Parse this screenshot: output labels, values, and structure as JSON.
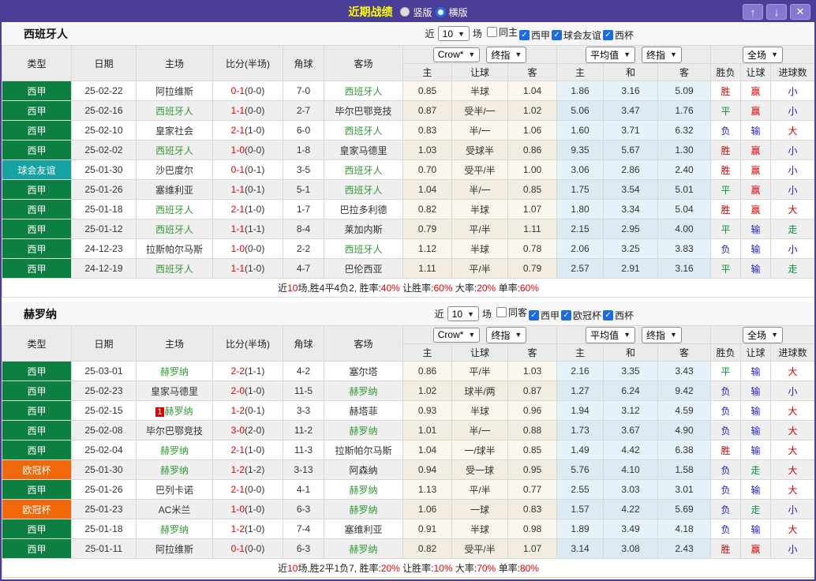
{
  "titlebar": {
    "title": "近期战绩",
    "radio_vertical": "竖版",
    "radio_horizontal": "横版",
    "up_icon": "↑",
    "down_icon": "↓",
    "close_icon": "✕"
  },
  "colors": {
    "accent_purple": "#4a3e96",
    "league": {
      "西甲": "#0d7f41",
      "球会友谊": "#16a3a3",
      "欧冠杯": "#f0680a"
    },
    "char": {
      "胜": "#dd0000",
      "平": "#009933",
      "负": "#2222cc",
      "赢": "#dd0000",
      "输": "#2222cc",
      "走": "#009933",
      "大": "#dd0000",
      "小": "#2222cc"
    }
  },
  "header_labels": {
    "recent_prefix": "近",
    "recent_suffix": "场",
    "col_type": "类型",
    "col_date": "日期",
    "col_home": "主场",
    "col_score": "比分(半场)",
    "col_corner": "角球",
    "col_away": "客场",
    "dd_crow": "Crow*",
    "dd_final1": "终指",
    "dd_avg": "平均值",
    "dd_final2": "终指",
    "dd_fulltime": "全场",
    "sub_home": "主",
    "sub_handicap": "让球",
    "sub_away": "客",
    "sub_avg_home": "主",
    "sub_draw": "和",
    "sub_avg_away": "客",
    "col_result": "胜负",
    "col_handicap_result": "让球",
    "col_goals": "进球数"
  },
  "tables": [
    {
      "team": "西班牙人",
      "recent_count": "10",
      "filters": [
        {
          "label": "同主",
          "checked": false
        },
        {
          "label": "西甲",
          "checked": true
        },
        {
          "label": "球会友谊",
          "checked": true
        },
        {
          "label": "西杯",
          "checked": true
        }
      ],
      "rows": [
        {
          "league": "西甲",
          "date": "25-02-22",
          "home": "阿拉维斯",
          "score": "0-1",
          "half": "(0-0)",
          "corner": "7-0",
          "away": "西班牙人",
          "crow_home": "0.85",
          "handicap": "半球",
          "crow_away": "1.04",
          "avg_home": "1.86",
          "avg_draw": "3.16",
          "avg_away": "5.09",
          "result": "胜",
          "handicap_result": "赢",
          "goals": "小"
        },
        {
          "league": "西甲",
          "date": "25-02-16",
          "home": "西班牙人",
          "score": "1-1",
          "half": "(0-0)",
          "corner": "2-7",
          "away": "毕尔巴鄂竞技",
          "crow_home": "0.87",
          "handicap": "受半/一",
          "crow_away": "1.02",
          "avg_home": "5.06",
          "avg_draw": "3.47",
          "avg_away": "1.76",
          "result": "平",
          "handicap_result": "赢",
          "goals": "小"
        },
        {
          "league": "西甲",
          "date": "25-02-10",
          "home": "皇家社会",
          "score": "2-1",
          "half": "(1-0)",
          "corner": "6-0",
          "away": "西班牙人",
          "crow_home": "0.83",
          "handicap": "半/一",
          "crow_away": "1.06",
          "avg_home": "1.60",
          "avg_draw": "3.71",
          "avg_away": "6.32",
          "result": "负",
          "handicap_result": "输",
          "goals": "大"
        },
        {
          "league": "西甲",
          "date": "25-02-02",
          "home": "西班牙人",
          "score": "1-0",
          "half": "(0-0)",
          "corner": "1-8",
          "away": "皇家马德里",
          "crow_home": "1.03",
          "handicap": "受球半",
          "crow_away": "0.86",
          "avg_home": "9.35",
          "avg_draw": "5.67",
          "avg_away": "1.30",
          "result": "胜",
          "handicap_result": "赢",
          "goals": "小"
        },
        {
          "league": "球会友谊",
          "date": "25-01-30",
          "home": "沙巴度尔",
          "score": "0-1",
          "half": "(0-1)",
          "corner": "3-5",
          "away": "西班牙人",
          "crow_home": "0.70",
          "handicap": "受平/半",
          "crow_away": "1.00",
          "avg_home": "3.06",
          "avg_draw": "2.86",
          "avg_away": "2.40",
          "result": "胜",
          "handicap_result": "赢",
          "goals": "小"
        },
        {
          "league": "西甲",
          "date": "25-01-26",
          "home": "塞维利亚",
          "score": "1-1",
          "half": "(0-1)",
          "corner": "5-1",
          "away": "西班牙人",
          "crow_home": "1.04",
          "handicap": "半/一",
          "crow_away": "0.85",
          "avg_home": "1.75",
          "avg_draw": "3.54",
          "avg_away": "5.01",
          "result": "平",
          "handicap_result": "赢",
          "goals": "小"
        },
        {
          "league": "西甲",
          "date": "25-01-18",
          "home": "西班牙人",
          "score": "2-1",
          "half": "(1-0)",
          "corner": "1-7",
          "away": "巴拉多利德",
          "crow_home": "0.82",
          "handicap": "半球",
          "crow_away": "1.07",
          "avg_home": "1.80",
          "avg_draw": "3.34",
          "avg_away": "5.04",
          "result": "胜",
          "handicap_result": "赢",
          "goals": "大"
        },
        {
          "league": "西甲",
          "date": "25-01-12",
          "home": "西班牙人",
          "score": "1-1",
          "half": "(1-1)",
          "corner": "8-4",
          "away": "莱加内斯",
          "crow_home": "0.79",
          "handicap": "平/半",
          "crow_away": "1.11",
          "avg_home": "2.15",
          "avg_draw": "2.95",
          "avg_away": "4.00",
          "result": "平",
          "handicap_result": "输",
          "goals": "走"
        },
        {
          "league": "西甲",
          "date": "24-12-23",
          "home": "拉斯帕尔马斯",
          "score": "1-0",
          "half": "(0-0)",
          "corner": "2-2",
          "away": "西班牙人",
          "crow_home": "1.12",
          "handicap": "半球",
          "crow_away": "0.78",
          "avg_home": "2.06",
          "avg_draw": "3.25",
          "avg_away": "3.83",
          "result": "负",
          "handicap_result": "输",
          "goals": "小"
        },
        {
          "league": "西甲",
          "date": "24-12-19",
          "home": "西班牙人",
          "score": "1-1",
          "half": "(1-0)",
          "corner": "4-7",
          "away": "巴伦西亚",
          "crow_home": "1.11",
          "handicap": "平/半",
          "crow_away": "0.79",
          "avg_home": "2.57",
          "avg_draw": "2.91",
          "avg_away": "3.16",
          "result": "平",
          "handicap_result": "输",
          "goals": "走"
        }
      ],
      "summary": [
        {
          "t": "近"
        },
        {
          "t": "10",
          "red": true
        },
        {
          "t": "场,胜4平4负2, 胜率:"
        },
        {
          "t": "40%",
          "red": true
        },
        {
          "t": " 让胜率:"
        },
        {
          "t": "60%",
          "red": true
        },
        {
          "t": " 大率:"
        },
        {
          "t": "20%",
          "red": true
        },
        {
          "t": " 单率:"
        },
        {
          "t": "60%",
          "red": true
        }
      ]
    },
    {
      "team": "赫罗纳",
      "recent_count": "10",
      "filters": [
        {
          "label": "同客",
          "checked": false
        },
        {
          "label": "西甲",
          "checked": true
        },
        {
          "label": "欧冠杯",
          "checked": true
        },
        {
          "label": "西杯",
          "checked": true
        }
      ],
      "rows": [
        {
          "league": "西甲",
          "date": "25-03-01",
          "home": "赫罗纳",
          "score": "2-2",
          "half": "(1-1)",
          "corner": "4-2",
          "away": "塞尔塔",
          "crow_home": "0.86",
          "handicap": "平/半",
          "crow_away": "1.03",
          "avg_home": "2.16",
          "avg_draw": "3.35",
          "avg_away": "3.43",
          "result": "平",
          "handicap_result": "输",
          "goals": "大"
        },
        {
          "league": "西甲",
          "date": "25-02-23",
          "home": "皇家马德里",
          "score": "2-0",
          "half": "(1-0)",
          "corner": "11-5",
          "away": "赫罗纳",
          "crow_home": "1.02",
          "handicap": "球半/两",
          "crow_away": "0.87",
          "avg_home": "1.27",
          "avg_draw": "6.24",
          "avg_away": "9.42",
          "result": "负",
          "handicap_result": "输",
          "goals": "小"
        },
        {
          "league": "西甲",
          "date": "25-02-15",
          "home": "赫罗纳",
          "card": "1",
          "score": "1-2",
          "half": "(0-1)",
          "corner": "3-3",
          "away": "赫塔菲",
          "crow_home": "0.93",
          "handicap": "半球",
          "crow_away": "0.96",
          "avg_home": "1.94",
          "avg_draw": "3.12",
          "avg_away": "4.59",
          "result": "负",
          "handicap_result": "输",
          "goals": "大"
        },
        {
          "league": "西甲",
          "date": "25-02-08",
          "home": "毕尔巴鄂竞技",
          "score": "3-0",
          "half": "(2-0)",
          "corner": "11-2",
          "away": "赫罗纳",
          "crow_home": "1.01",
          "handicap": "半/一",
          "crow_away": "0.88",
          "avg_home": "1.73",
          "avg_draw": "3.67",
          "avg_away": "4.90",
          "result": "负",
          "handicap_result": "输",
          "goals": "大"
        },
        {
          "league": "西甲",
          "date": "25-02-04",
          "home": "赫罗纳",
          "score": "2-1",
          "half": "(1-0)",
          "corner": "11-3",
          "away": "拉斯帕尔马斯",
          "crow_home": "1.04",
          "handicap": "一/球半",
          "crow_away": "0.85",
          "avg_home": "1.49",
          "avg_draw": "4.42",
          "avg_away": "6.38",
          "result": "胜",
          "handicap_result": "输",
          "goals": "大"
        },
        {
          "league": "欧冠杯",
          "date": "25-01-30",
          "home": "赫罗纳",
          "score": "1-2",
          "half": "(1-2)",
          "corner": "3-13",
          "away": "阿森纳",
          "crow_home": "0.94",
          "handicap": "受一球",
          "crow_away": "0.95",
          "avg_home": "5.76",
          "avg_draw": "4.10",
          "avg_away": "1.58",
          "result": "负",
          "handicap_result": "走",
          "goals": "大"
        },
        {
          "league": "西甲",
          "date": "25-01-26",
          "home": "巴列卡诺",
          "score": "2-1",
          "half": "(0-0)",
          "corner": "4-1",
          "away": "赫罗纳",
          "crow_home": "1.13",
          "handicap": "平/半",
          "crow_away": "0.77",
          "avg_home": "2.55",
          "avg_draw": "3.03",
          "avg_away": "3.01",
          "result": "负",
          "handicap_result": "输",
          "goals": "大"
        },
        {
          "league": "欧冠杯",
          "date": "25-01-23",
          "home": "AC米兰",
          "score": "1-0",
          "half": "(1-0)",
          "corner": "6-3",
          "away": "赫罗纳",
          "crow_home": "1.06",
          "handicap": "一球",
          "crow_away": "0.83",
          "avg_home": "1.57",
          "avg_draw": "4.22",
          "avg_away": "5.69",
          "result": "负",
          "handicap_result": "走",
          "goals": "小"
        },
        {
          "league": "西甲",
          "date": "25-01-18",
          "home": "赫罗纳",
          "score": "1-2",
          "half": "(1-0)",
          "corner": "7-4",
          "away": "塞维利亚",
          "crow_home": "0.91",
          "handicap": "半球",
          "crow_away": "0.98",
          "avg_home": "1.89",
          "avg_draw": "3.49",
          "avg_away": "4.18",
          "result": "负",
          "handicap_result": "输",
          "goals": "大"
        },
        {
          "league": "西甲",
          "date": "25-01-11",
          "home": "阿拉维斯",
          "score": "0-1",
          "half": "(0-0)",
          "corner": "6-3",
          "away": "赫罗纳",
          "crow_home": "0.82",
          "handicap": "受平/半",
          "crow_away": "1.07",
          "avg_home": "3.14",
          "avg_draw": "3.08",
          "avg_away": "2.43",
          "result": "胜",
          "handicap_result": "赢",
          "goals": "小"
        }
      ],
      "summary": [
        {
          "t": "近"
        },
        {
          "t": "10",
          "red": true
        },
        {
          "t": "场,胜2平1负7, 胜率:"
        },
        {
          "t": "20%",
          "red": true
        },
        {
          "t": " 让胜率:"
        },
        {
          "t": "10%",
          "red": true
        },
        {
          "t": " 大率:"
        },
        {
          "t": "70%",
          "red": true
        },
        {
          "t": " 单率:"
        },
        {
          "t": "80%",
          "red": true
        }
      ]
    }
  ]
}
